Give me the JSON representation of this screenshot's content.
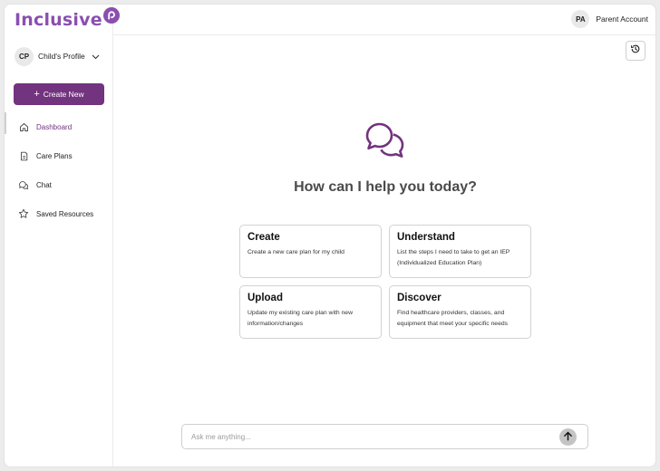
{
  "brand": {
    "name": "Inclusive",
    "color": "#8a4fb0"
  },
  "sidebar": {
    "profile": {
      "initials": "CP",
      "label": "Child's Profile",
      "icon": "chevron-down-icon"
    },
    "create_button": {
      "label": "Create New",
      "icon": "plus-icon",
      "color": "#72337f"
    },
    "items": [
      {
        "label": "Dashboard",
        "icon": "home-icon",
        "active": true
      },
      {
        "label": "Care Plans",
        "icon": "document-icon",
        "active": false
      },
      {
        "label": "Chat",
        "icon": "chat-icon",
        "active": false
      },
      {
        "label": "Saved Resources",
        "icon": "star-icon",
        "active": false
      }
    ]
  },
  "header": {
    "account_initials": "PA",
    "account_label": "Parent Account",
    "history_icon": "history-icon"
  },
  "main": {
    "hero_icon": "chat-bubbles-icon",
    "headline": "How can I help you today?",
    "cards": [
      {
        "title": "Create",
        "description": "Create a new care plan for my child"
      },
      {
        "title": "Understand",
        "description": "List the steps I need to take to get an IEP (Individualized Education Plan)"
      },
      {
        "title": "Upload",
        "description": "Update my existing care plan with new information/changes"
      },
      {
        "title": "Discover",
        "description": "Find healthcare providers, classes, and equipment that meet your specific needs"
      }
    ]
  },
  "chat_input": {
    "value": "",
    "placeholder": "Ask me anything...",
    "send_icon": "arrow-up-icon"
  }
}
